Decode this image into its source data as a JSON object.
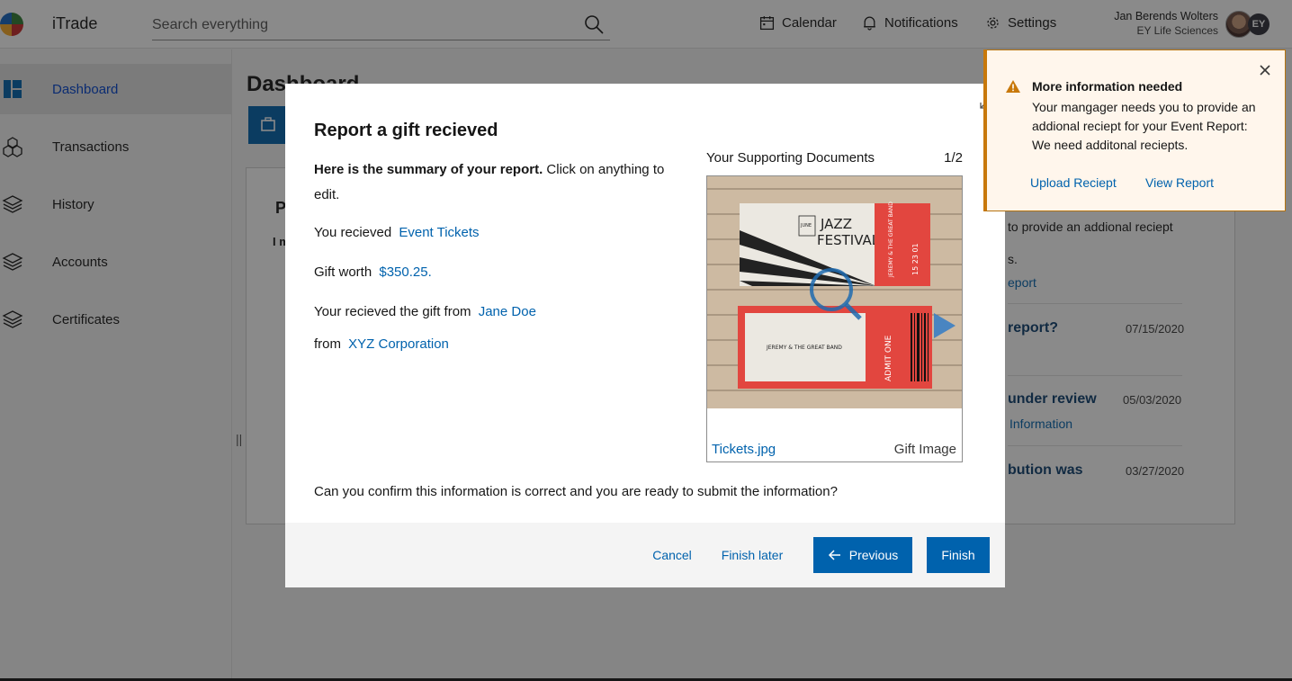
{
  "app": {
    "name": "iTrade"
  },
  "search": {
    "placeholder": "Search everything"
  },
  "header": {
    "calendar_label": "Calendar",
    "notifications_label": "Notifications",
    "settings_label": "Settings",
    "user_name": "Jan Berends Wolters",
    "user_org": "EY Life Sciences",
    "badge": "EY"
  },
  "sidebar": {
    "items": [
      {
        "label": "Dashboard",
        "icon": "dashboard-icon",
        "active": true
      },
      {
        "label": "Transactions",
        "icon": "cubes-icon",
        "active": false
      },
      {
        "label": "History",
        "icon": "layers-icon",
        "active": false
      },
      {
        "label": "Accounts",
        "icon": "layers-icon",
        "active": false
      },
      {
        "label": "Certificates",
        "icon": "layers-icon",
        "active": false
      }
    ],
    "resize_glyph": "||"
  },
  "dashboard": {
    "title": "Dashboard",
    "card_heading_partial": "P",
    "card_subheading_partial": "I m",
    "notice_fragment": "to provide an addional reciept",
    "notice_fragment_2": "s.",
    "notice_link": "eport",
    "items": [
      {
        "title": "report?",
        "date": "07/15/2020"
      },
      {
        "title": "under review",
        "date": "05/03/2020",
        "link": "Information"
      },
      {
        "title": "bution was",
        "date": "03/27/2020"
      }
    ]
  },
  "modal": {
    "title": "Report a gift recieved",
    "summary_bold": "Here is the summary of your report.",
    "summary_rest": " Click on anything to edit.",
    "received_label": "You recieved",
    "received_value": "Event Tickets",
    "worth_label": "Gift worth",
    "worth_value": "$350.25.",
    "from_person_label": "Your recieved the gift from",
    "from_person_value": "Jane Doe",
    "from_company_label": "from",
    "from_company_value": "XYZ Corporation",
    "confirm_text": "Can you confirm this information is correct and you are ready to submit the information?",
    "documents": {
      "title": "Your Supporting Documents",
      "counter": "1/2",
      "file_name": "Tickets.jpg",
      "caption": "Gift Image"
    },
    "buttons": {
      "cancel": "Cancel",
      "finish_later": "Finish later",
      "previous": "Previous",
      "finish": "Finish"
    }
  },
  "ticket_image": {
    "festival_title_1": "JAZZ",
    "festival_title_2": "FESTIVAL",
    "month": "JUNE",
    "band": "JEREMY & THE GREAT BAND",
    "band_small": "JEREMY & THE GREAT BAND",
    "admit": "ADMIT ONE",
    "stub_numbers": "15 23 01"
  },
  "toast": {
    "title": "More information needed",
    "body": "Your mangager needs you to provide an addional reciept for your Event Report: We need additonal reciepts.",
    "upload_link": "Upload Reciept",
    "view_link": "View Report"
  },
  "colors": {
    "primary": "#0062ad",
    "warning_border": "#c8780a",
    "overlay": "rgba(22,22,22,0.5)"
  }
}
